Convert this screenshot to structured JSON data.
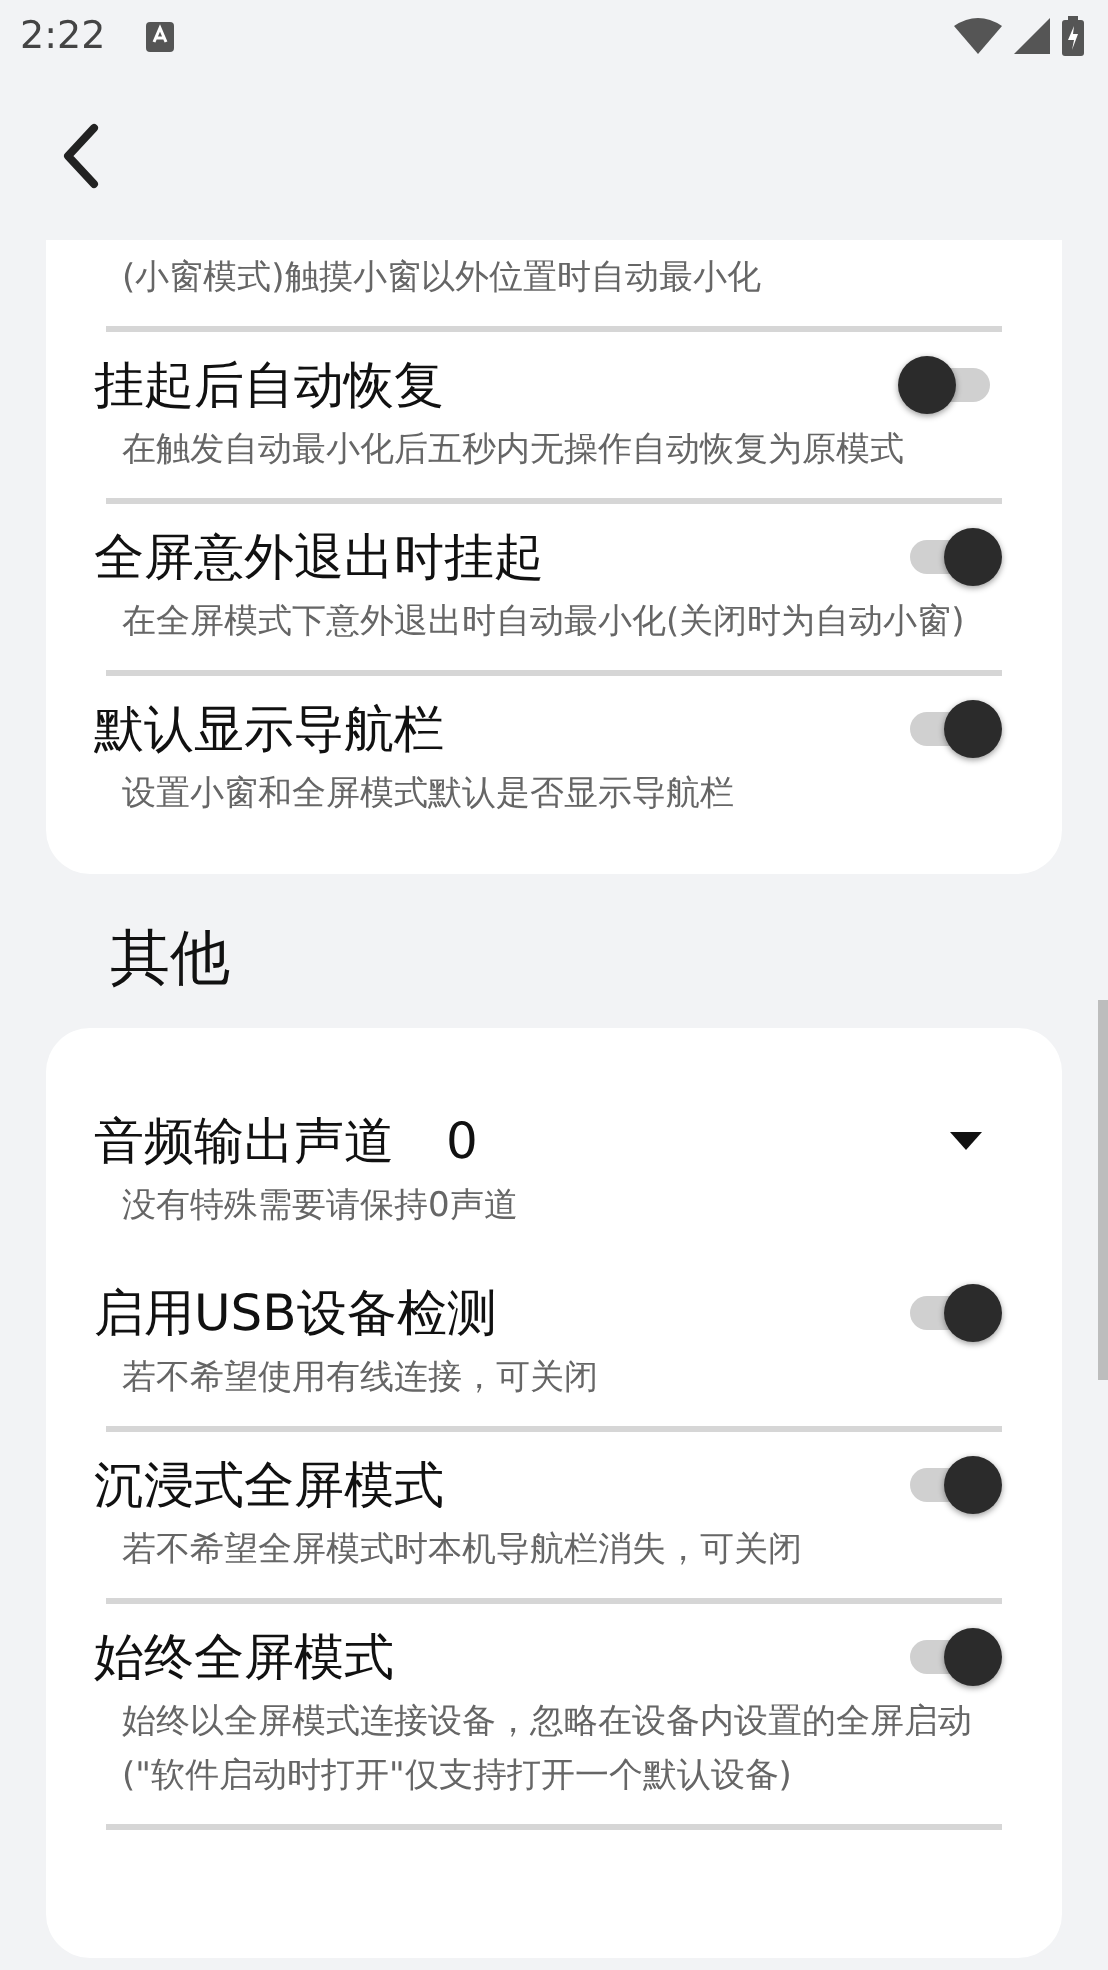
{
  "status_bar": {
    "time": "2:22"
  },
  "sections": [
    {
      "items": [
        {
          "kind": "note",
          "description": "(小窗模式)触摸小窗以外位置时自动最小化"
        },
        {
          "kind": "switch",
          "title": "挂起后自动恢复",
          "on": false,
          "description": "在触发自动最小化后五秒内无操作自动恢复为原模式"
        },
        {
          "kind": "switch",
          "title": "全屏意外退出时挂起",
          "on": true,
          "description": "在全屏模式下意外退出时自动最小化(关闭时为自动小窗)"
        },
        {
          "kind": "switch",
          "title": "默认显示导航栏",
          "on": true,
          "description": "设置小窗和全屏模式默认是否显示导航栏"
        }
      ]
    },
    {
      "title": "其他",
      "items": [
        {
          "kind": "dropdown",
          "title": "音频输出声道",
          "value": "0",
          "description": "没有特殊需要请保持0声道"
        },
        {
          "kind": "switch",
          "title": "启用USB设备检测",
          "on": true,
          "description": "若不希望使用有线连接，可关闭"
        },
        {
          "kind": "switch",
          "title": "沉浸式全屏模式",
          "on": true,
          "description": "若不希望全屏模式时本机导航栏消失，可关闭"
        },
        {
          "kind": "switch",
          "title": "始终全屏模式",
          "on": true,
          "description": "始终以全屏模式连接设备，忽略在设备内设置的全屏启动(\"软件启动时打开\"仅支持打开一个默认设备)"
        }
      ]
    }
  ]
}
